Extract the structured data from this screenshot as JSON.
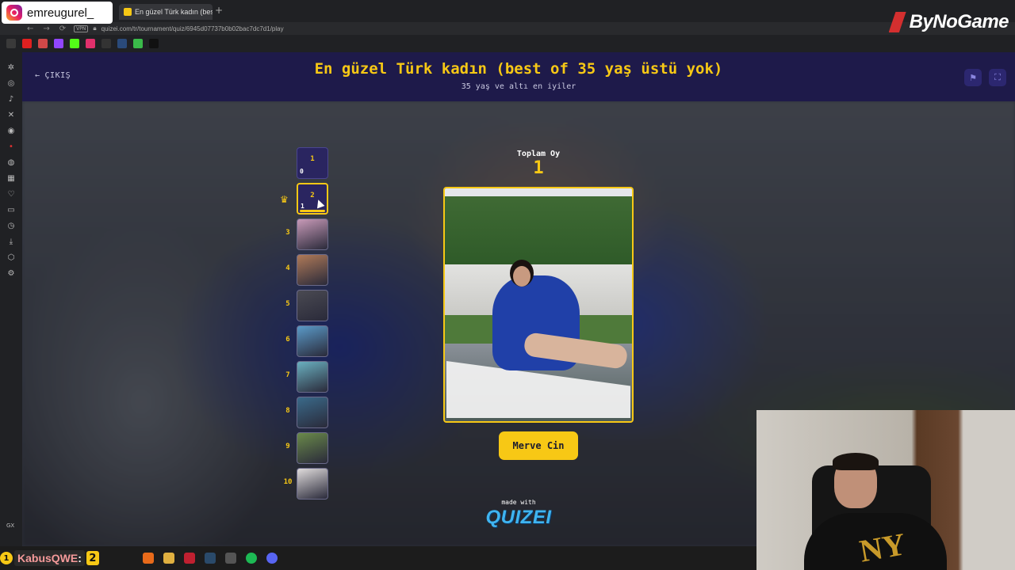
{
  "overlay": {
    "instagram_handle": "emreugurel_",
    "brand": "ByNoGame",
    "kick_user": "KabusQWE",
    "kick_sep": ":",
    "kick_count": "2",
    "kick_badge": "1"
  },
  "browser": {
    "tab_title": "En güzel Türk kadın (best",
    "url": "quizei.com/tr/tournament/quiz/6945d07737b0b02bac7dc7d1/play",
    "vpn_label": "VPN"
  },
  "side_rail": {
    "bottom_label": "GX"
  },
  "header": {
    "exit_label": "ÇIKIŞ",
    "title": "En güzel Türk kadın (best of 35 yaş üstü yok)",
    "subtitle": "35 yaş ve altı en iyiler"
  },
  "votes": {
    "label": "Toplam Oy",
    "value": "1"
  },
  "ranking": [
    {
      "rank": "1",
      "votes": "0",
      "type": "card"
    },
    {
      "rank": "2",
      "votes": "1",
      "type": "card",
      "active": true
    },
    {
      "rank": "3",
      "type": "thumb",
      "color": "#c89ab8"
    },
    {
      "rank": "4",
      "type": "thumb",
      "color": "#b07a58"
    },
    {
      "rank": "5",
      "type": "thumb",
      "color": "#4a4a52"
    },
    {
      "rank": "6",
      "type": "thumb",
      "color": "#5a9ac8"
    },
    {
      "rank": "7",
      "type": "thumb",
      "color": "#6ab0c0"
    },
    {
      "rank": "8",
      "type": "thumb",
      "color": "#3a6a8a"
    },
    {
      "rank": "9",
      "type": "thumb",
      "color": "#6a8a4a"
    },
    {
      "rank": "10",
      "type": "thumb",
      "color": "#e0dcdc"
    }
  ],
  "candidate": {
    "name": "Merve Cin"
  },
  "footer": {
    "made_with": "made with",
    "logo": "QUIZEI"
  },
  "colors": {
    "accent": "#f7c815",
    "header_bg": "#1e1a4a",
    "card_bg": "#2a2560",
    "logo_blue": "#3fb4f0"
  }
}
